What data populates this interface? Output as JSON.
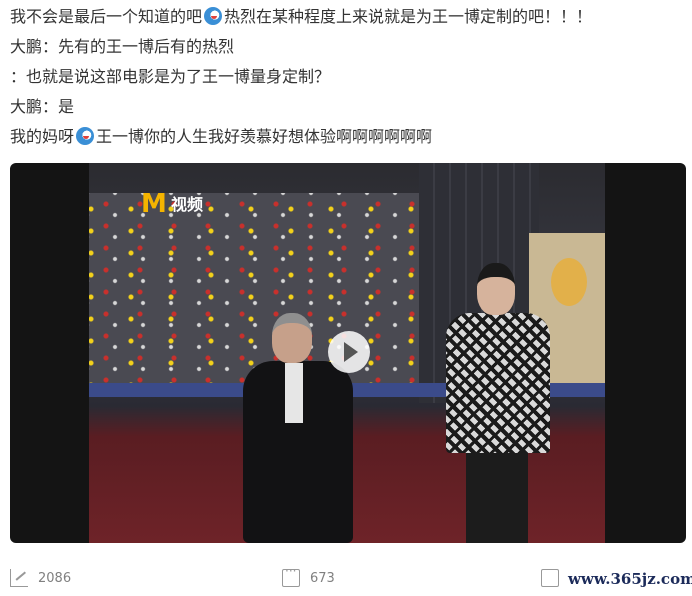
{
  "post": {
    "lines": [
      {
        "before": "我不会是最后一个知道的吧",
        "emoji": "doge-emoji",
        "after": "热烈在某种程度上来说就是为王一博定制的吧！！！"
      },
      {
        "text": "大鹏：先有的王一博后有的热烈"
      },
      {
        "text": "：也就是说这部电影是为了王一博量身定制？"
      },
      {
        "text": "大鹏：是"
      },
      {
        "before": "我的妈呀",
        "emoji": "doge-emoji",
        "after": "王一博你的人生我好羡慕好想体验啊啊啊啊啊啊"
      }
    ]
  },
  "video": {
    "logo_m": "M",
    "logo_text": "视频",
    "play_icon": "play-icon"
  },
  "actions": {
    "repost": {
      "icon": "repost-icon",
      "count": "2086"
    },
    "comment": {
      "icon": "comment-icon",
      "count": "673"
    },
    "like": {
      "icon": "like-icon"
    }
  },
  "watermark": "www.365jz.com",
  "colors": {
    "text": "#333333",
    "muted": "#808080",
    "video_bg": "#141414",
    "logo": "#f5b400",
    "carpet": "#6e2328"
  }
}
